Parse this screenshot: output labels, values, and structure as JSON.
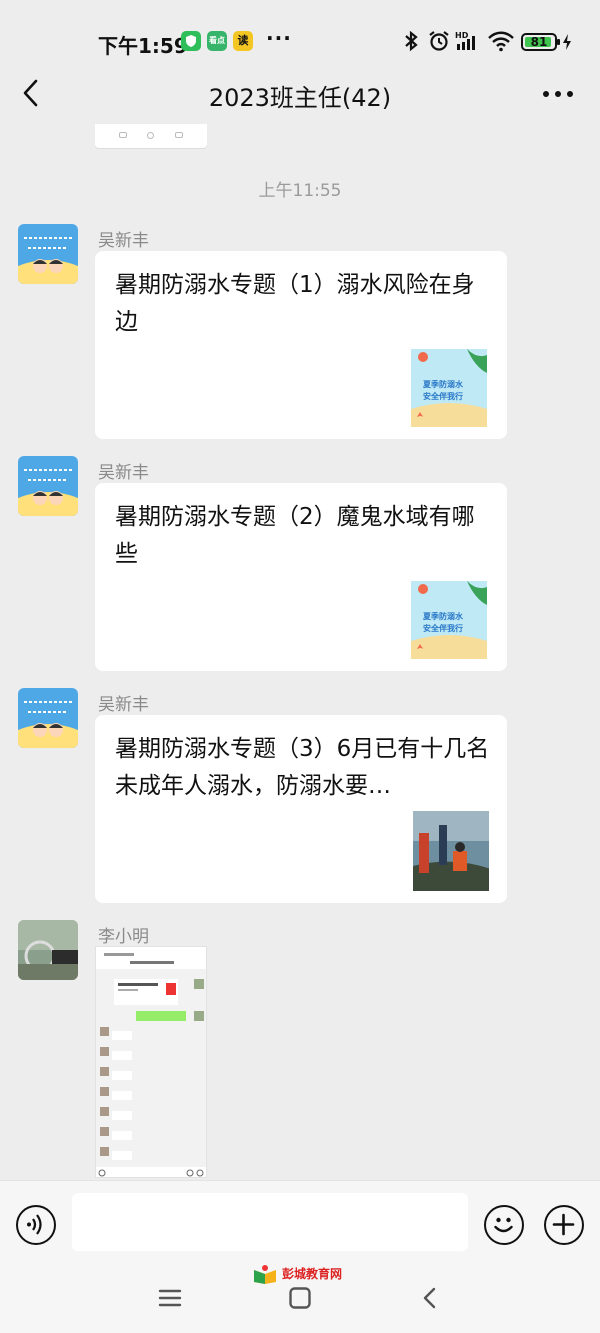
{
  "status_bar": {
    "time": "下午1:59",
    "apps": [
      {
        "icon": "shield-app-icon",
        "color": "#2fbf5a",
        "label": ""
      },
      {
        "icon": "kan-app-icon",
        "color": "#35b46a",
        "label": "看点"
      },
      {
        "icon": "read-app-icon",
        "color": "#f3c623",
        "label": "读"
      }
    ],
    "more": "···",
    "battery": "81"
  },
  "nav": {
    "title": "2023班主任(42)"
  },
  "timestamp": "上午11:55",
  "messages": [
    {
      "sender": "吴新丰",
      "title": "暑期防溺水专题（1）溺水风险在身边",
      "thumb_caption_1": "夏季防溺水",
      "thumb_caption_2": "安全伴我行"
    },
    {
      "sender": "吴新丰",
      "title": "暑期防溺水专题（2）魔鬼水域有哪些",
      "thumb_caption_1": "夏季防溺水",
      "thumb_caption_2": "安全伴我行"
    },
    {
      "sender": "吴新丰",
      "title": "暑期防溺水专题（3）6月已有十几名未成年人溺水，防溺水要…"
    },
    {
      "sender": "李小明"
    }
  ],
  "input": {
    "placeholder": ""
  },
  "watermark": "彭城教育网",
  "colors": {
    "background": "#ededed",
    "card": "#ffffff",
    "accent_green": "#41c34f"
  }
}
